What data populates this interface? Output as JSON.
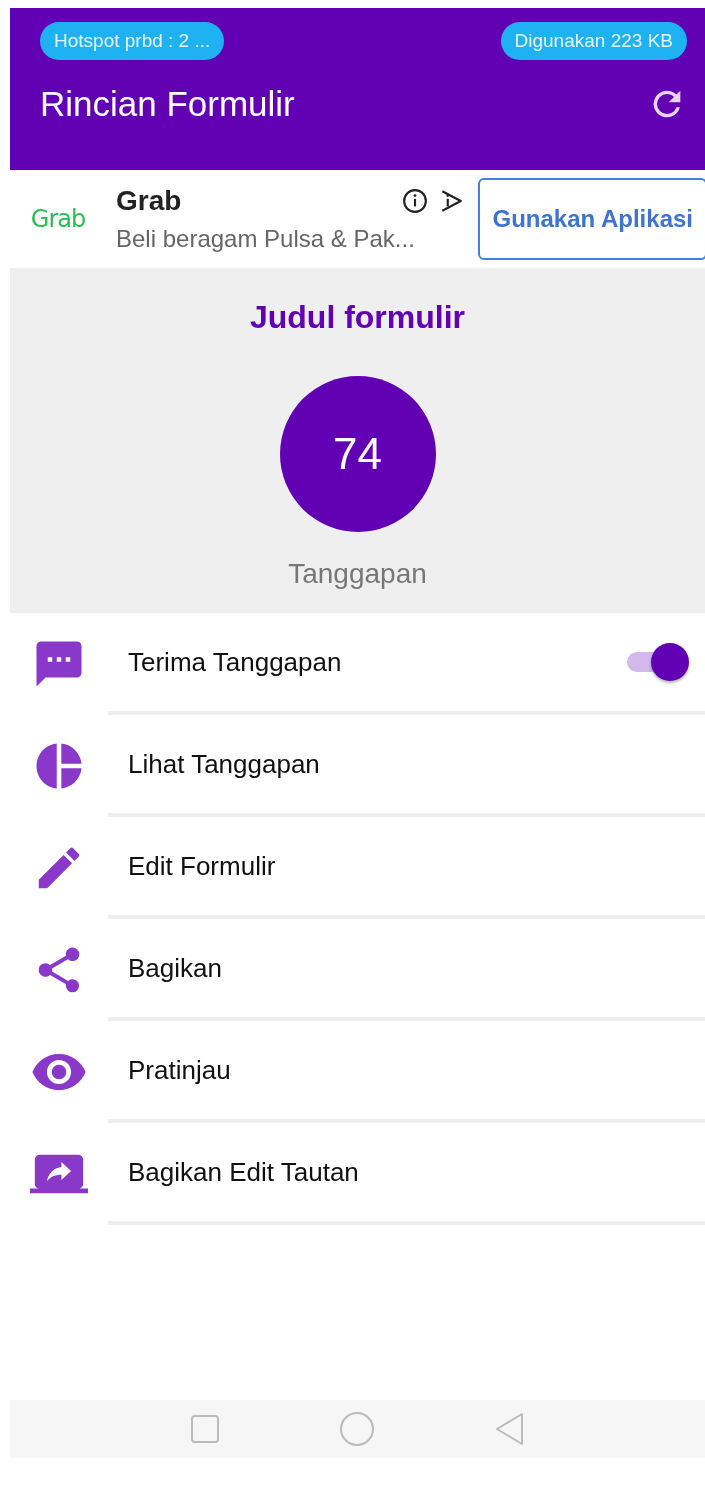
{
  "status_bar": {
    "hotspot": "Hotspot prbd : 2 ...",
    "usage": "Digunakan 223 KB"
  },
  "app_bar": {
    "title": "Rincian Formulir"
  },
  "ad": {
    "logo": "Grab",
    "title": "Grab",
    "description": "Beli beragam Pulsa & Pak...",
    "button": "Gunakan Aplikasi"
  },
  "summary": {
    "title": "Judul formulir",
    "count": "74",
    "caption": "Tanggapan"
  },
  "menu": [
    {
      "kind": "toggle",
      "label": "Terima Tanggapan",
      "on": true
    },
    {
      "kind": "link",
      "label": "Lihat Tanggapan"
    },
    {
      "kind": "link",
      "label": "Edit Formulir"
    },
    {
      "kind": "link",
      "label": "Bagikan"
    },
    {
      "kind": "link",
      "label": "Pratinjau"
    },
    {
      "kind": "link",
      "label": "Bagikan Edit Tautan"
    }
  ]
}
